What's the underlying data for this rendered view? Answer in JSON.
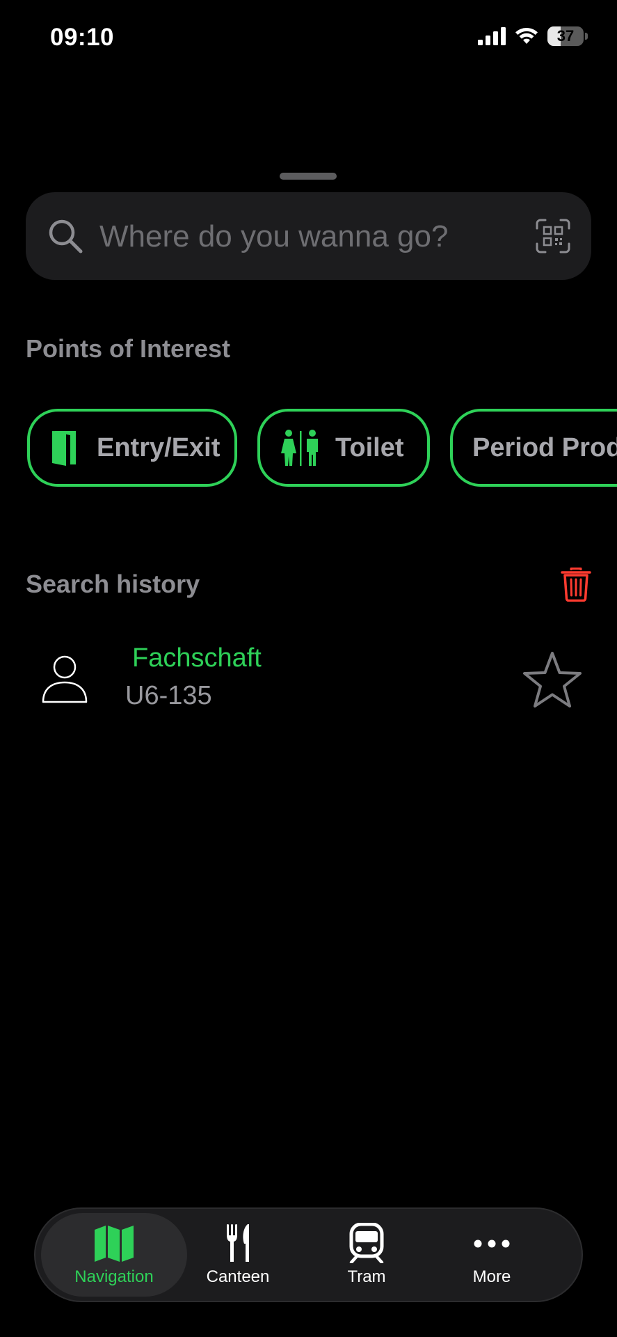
{
  "status_bar": {
    "time": "09:10",
    "battery": "37",
    "battery_level": 0.37
  },
  "search": {
    "placeholder": "Where do you wanna go?",
    "value": ""
  },
  "poi": {
    "title": "Points of Interest",
    "chips": [
      {
        "label": "Entry/Exit",
        "icon": "door-icon"
      },
      {
        "label": "Toilet",
        "icon": "restroom-icon"
      },
      {
        "label": "Period Products",
        "icon": ""
      }
    ]
  },
  "history": {
    "title": "Search history",
    "items": [
      {
        "name": "Fachschaft",
        "room": "U6-135",
        "icon": "person-icon",
        "favorite": false
      }
    ]
  },
  "tabs": [
    {
      "label": "Navigation",
      "icon": "map-icon",
      "active": true
    },
    {
      "label": "Canteen",
      "icon": "fork-knife-icon",
      "active": false
    },
    {
      "label": "Tram",
      "icon": "tram-icon",
      "active": false
    },
    {
      "label": "More",
      "icon": "ellipsis-icon",
      "active": false
    }
  ],
  "colors": {
    "accent": "#2ed158",
    "background": "#000000",
    "surface": "#1c1c1e",
    "muted_text": "#8d8d92",
    "destructive": "#ff3b30"
  }
}
